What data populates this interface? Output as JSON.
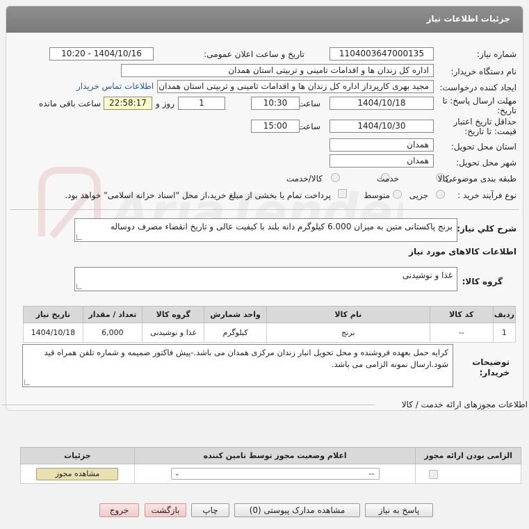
{
  "header": {
    "title": "جزئیات اطلاعات نیاز"
  },
  "form": {
    "need_number_label": "شماره نیاز:",
    "need_number": "1104003647000135",
    "announce_label": "تاریخ و ساعت اعلان عمومی:",
    "announce_value": "1404/10/16 - 10:20",
    "buyer_org_label": "نام دستگاه خریدار:",
    "buyer_org": "اداره کل زندان ها و اقدامات تامینی و تربیتی استان همدان",
    "requester_label": "ایجاد کننده درخواست:",
    "requester": "مجید بهری کارپرداز اداره کل زندان ها و اقدامات تامینی و تربیتی استان همدان",
    "contact_link": "اطلاعات تماس خریدار",
    "deadline_label_1": "مهلت ارسال پاسخ: تا",
    "deadline_label_2": "تاریخ:",
    "deadline_date": "1404/10/18",
    "time_label": "ساعت",
    "deadline_time": "10:30",
    "days_value": "1",
    "days_label": "روز و",
    "remaining_time": "22:58:17",
    "remaining_label": "ساعت باقی مانده",
    "validity_label_1": "حداقل تاریخ اعتبار",
    "validity_label_2": "قیمت: تا تاریخ:",
    "validity_date": "1404/10/30",
    "validity_time_label": "ساعت",
    "validity_time": "15:00",
    "province_label": "استان محل تحویل:",
    "province": "همدان",
    "city_label": "شهر محل تحویل:",
    "city": "همدان",
    "category_label": "طبقه بندی موضوعی:",
    "category_options": [
      "کالا",
      "خدمت",
      "کالا/خدمت"
    ],
    "process_label": "نوع فرآیند خرید :",
    "process_options": [
      "جزیی",
      "متوسط"
    ],
    "payment_note": "پرداخت تمام یا بخشی از مبلغ خرید،از محل \"اسناد خزانه اسلامی\" خواهد بود."
  },
  "summary": {
    "label": "شرح کلي نياز:",
    "text": "برنج پاکستانی متین به میزان 6.000 کیلوگرم دانه بلند با کیفیت عالی و تاریخ انقضاء مصرف دوساله"
  },
  "goods_section_title": "اطلاعات کالاهای مورد نیاز",
  "goods_group": {
    "label": "گروه کالا:",
    "value": "غذا و نوشیدنی"
  },
  "goods_table": {
    "headers": [
      "ردیف",
      "کد کالا",
      "نام کالا",
      "واحد شمارش",
      "گروه کالا",
      "تعداد / مقدار",
      "تاریخ نیاز"
    ],
    "rows": [
      [
        "1",
        "--",
        "برنج",
        "کیلوگرم",
        "غذا و نوشیدنی",
        "6,000",
        "1404/10/18"
      ]
    ]
  },
  "buyer_notes": {
    "label_1": "توضیحات",
    "label_2": "خریدار:",
    "text": "کرایه حمل بعهده فروشنده و محل تحویل انبار زندان مرکزی همدان می باشد.-پیش فاکتور ضمیمه و شماره تلفن همراه قید شود.ارسال نمونه الزامی می باشد."
  },
  "permits": {
    "title": "اطلاعات مجوزهای ارائه خدمت / کالا",
    "headers": [
      "الزامی بودن ارائه مجوز",
      "اعلام وضعیت مجوز توسط تامین کننده",
      "جزئیات"
    ],
    "select_value": "--",
    "view_button": "مشاهده مجوز"
  },
  "buttons": {
    "reply": "پاسخ به نیاز",
    "attachments": "مشاهده مدارک پیوستی (0)",
    "print": "چاپ",
    "back": "بازگشت",
    "exit": "خروج"
  }
}
